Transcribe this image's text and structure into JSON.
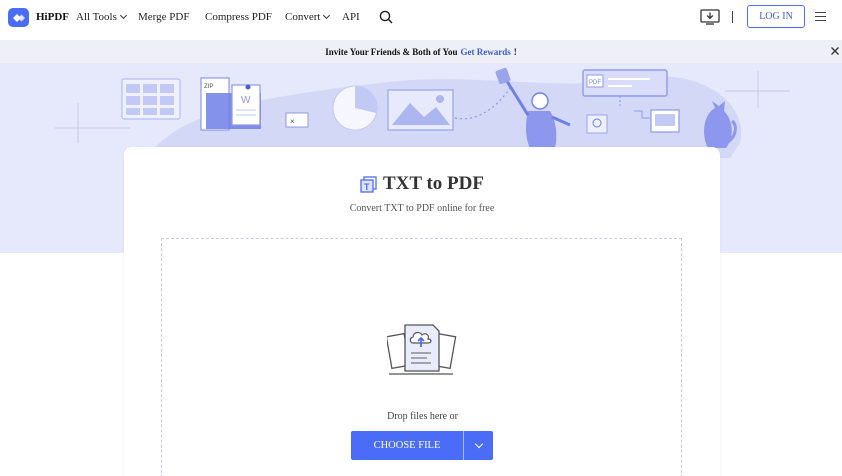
{
  "header": {
    "brand": "HiPDF",
    "nav": [
      "All Tools",
      "Merge PDF",
      "Compress PDF",
      "Convert",
      "API"
    ],
    "login_label": "LOG IN"
  },
  "invite": {
    "text": "Invite Your Friends & Both of You",
    "link": "Get Rewards",
    "suffix": "!"
  },
  "main": {
    "title": "TXT to PDF",
    "subtitle": "Convert TXT to PDF online for free",
    "drop_text": "Drop files here or",
    "choose_label": "CHOOSE FILE"
  },
  "hero_labels": {
    "zip": "ZIP",
    "word": "W",
    "pdf": "PDF"
  },
  "colors": {
    "accent": "#4a6cf7",
    "hero_bg": "#e6e9fb",
    "invite_bg": "#eff0f7"
  }
}
